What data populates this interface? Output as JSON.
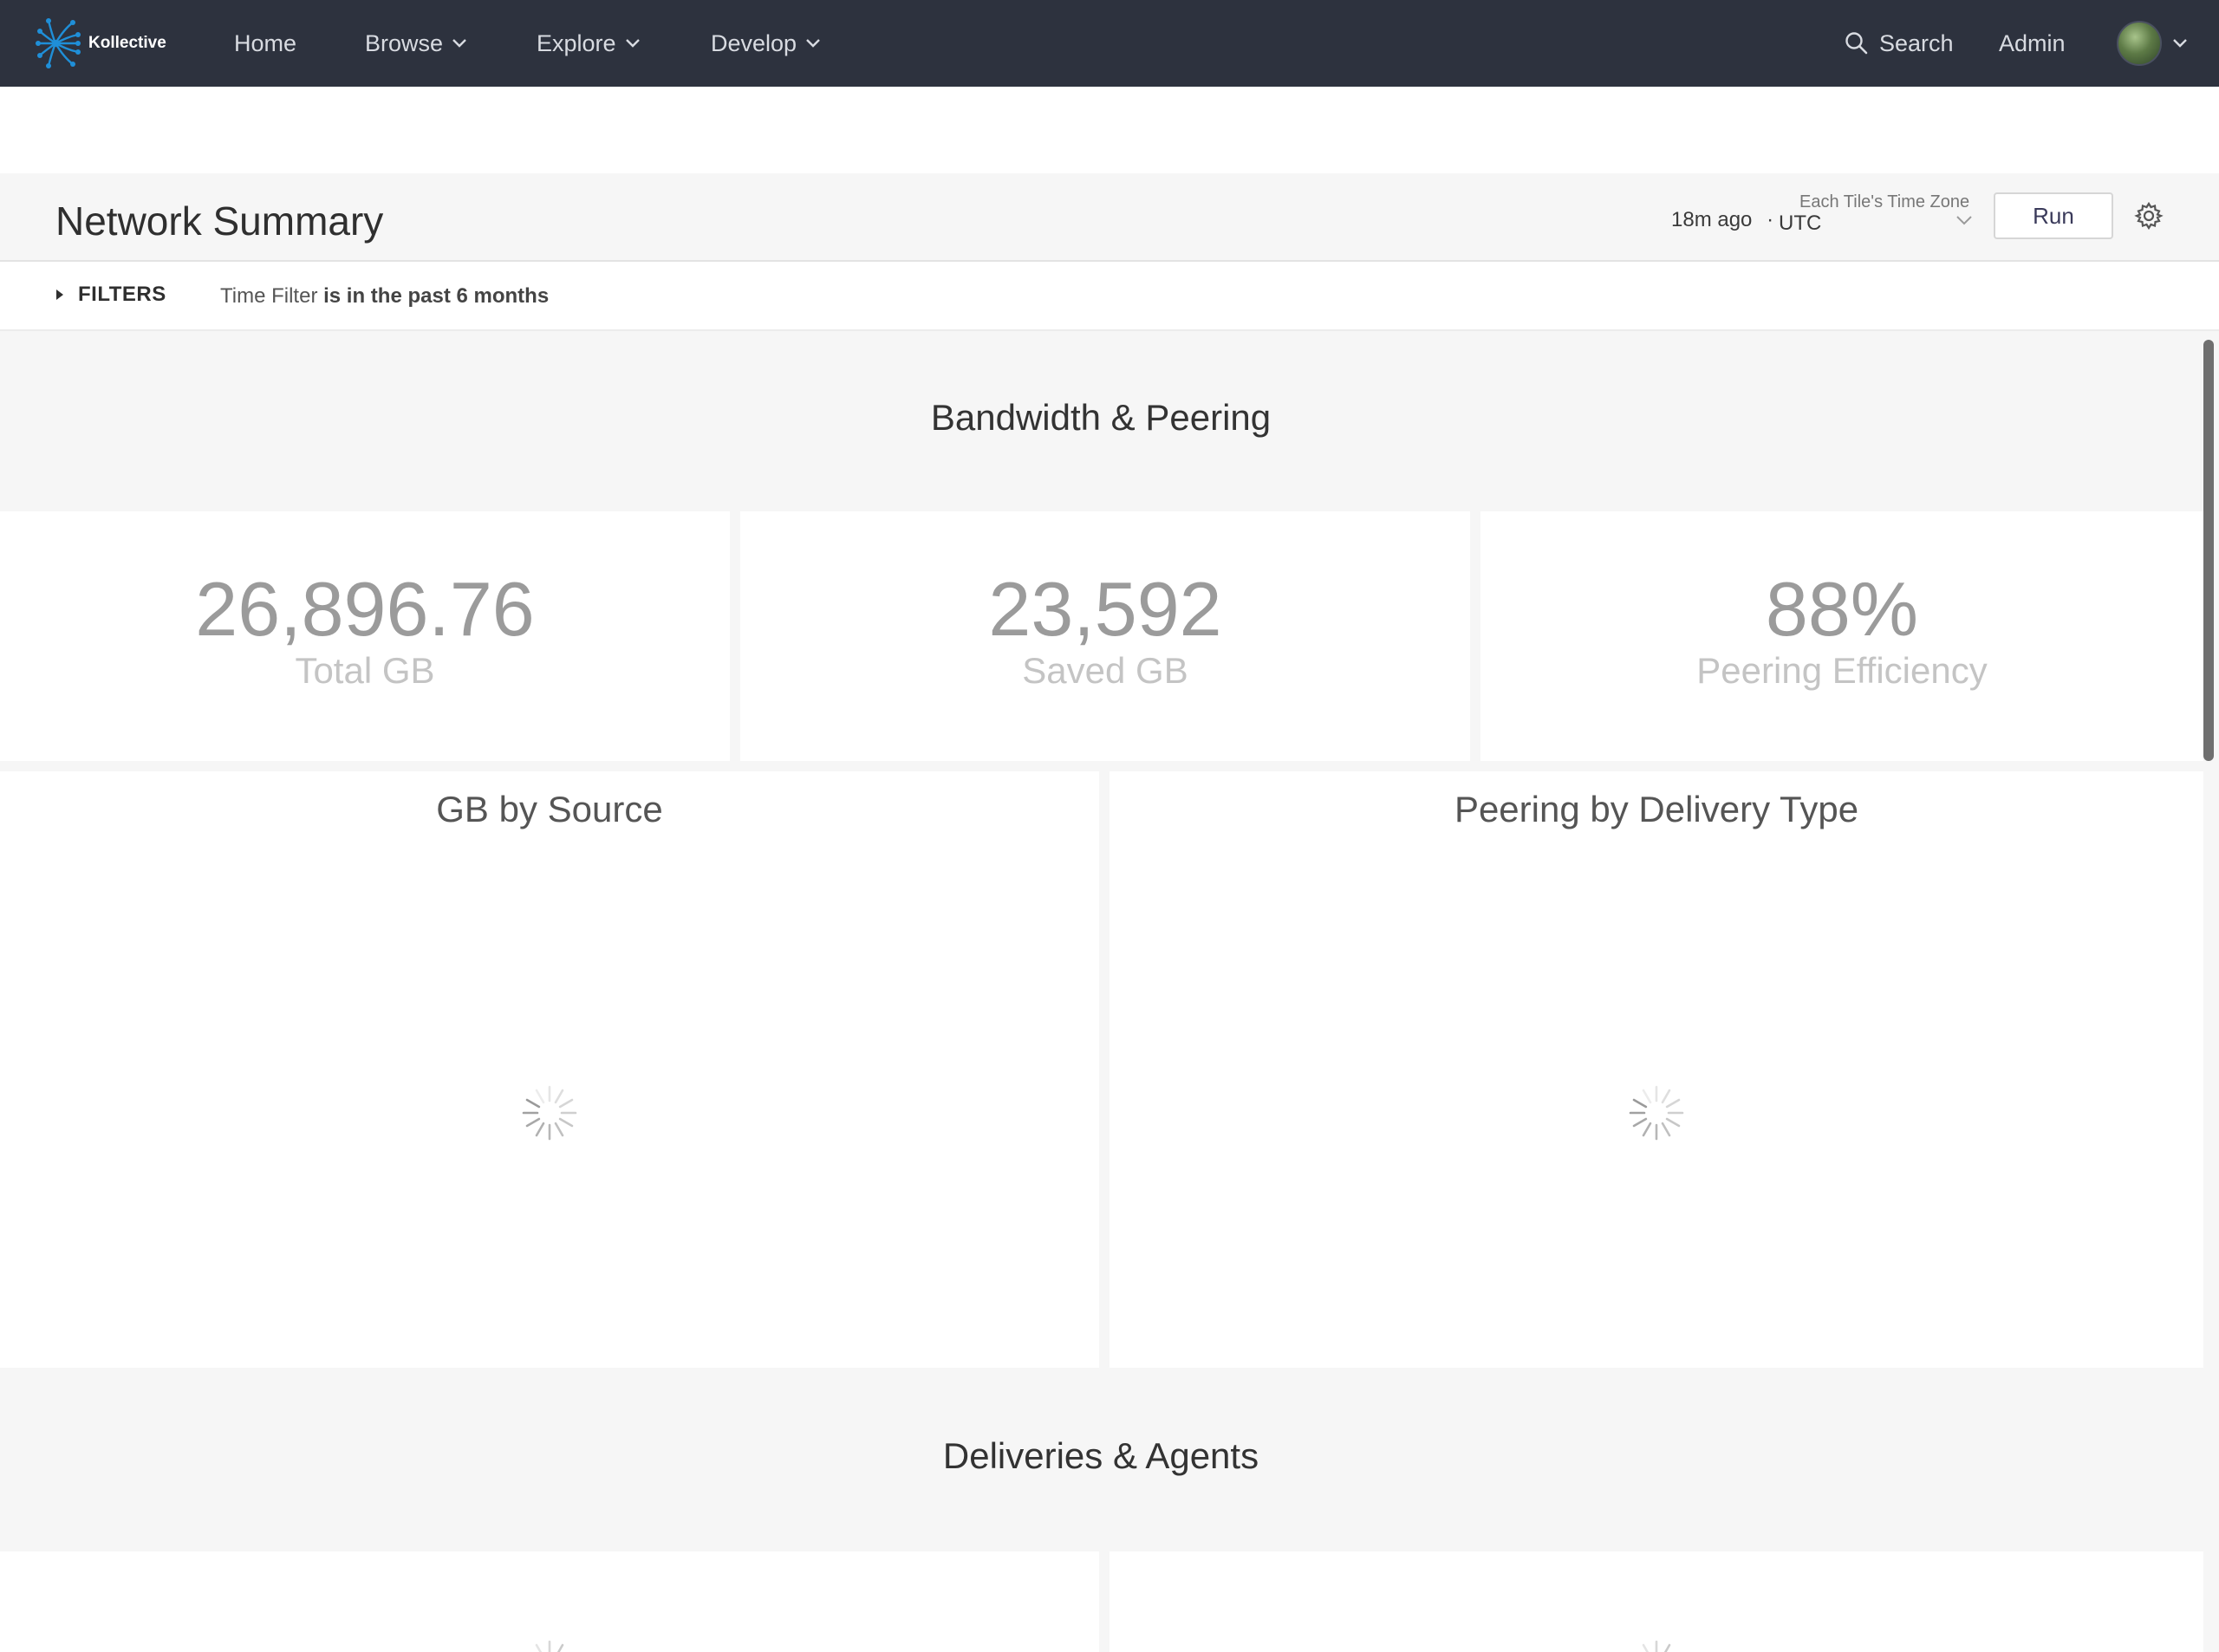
{
  "nav": {
    "brand": "Kollective",
    "items": [
      {
        "label": "Home",
        "has_menu": false
      },
      {
        "label": "Browse",
        "has_menu": true
      },
      {
        "label": "Explore",
        "has_menu": true
      },
      {
        "label": "Develop",
        "has_menu": true
      }
    ],
    "search_label": "Search",
    "admin_label": "Admin"
  },
  "dashboard": {
    "title": "Network Summary",
    "last_run": "18m ago",
    "separator": "·",
    "timezone_label": "Each Tile's Time Zone",
    "timezone_value": "UTC",
    "run_label": "Run"
  },
  "filters": {
    "toggle_label": "FILTERS",
    "field": "Time Filter",
    "condition": "is in the past 6 months"
  },
  "sections": [
    {
      "title": "Bandwidth & Peering"
    },
    {
      "title": "Deliveries & Agents"
    }
  ],
  "kpis": [
    {
      "value": "26,896.76",
      "label": "Total GB"
    },
    {
      "value": "23,592",
      "label": "Saved GB"
    },
    {
      "value": "88%",
      "label": "Peering Efficiency"
    }
  ],
  "charts": [
    {
      "title": "GB by Source",
      "state": "loading"
    },
    {
      "title": "Peering by Delivery Type",
      "state": "loading"
    }
  ],
  "colors": {
    "nav_bg": "#2d323e",
    "accent": "#1f8fd8"
  }
}
